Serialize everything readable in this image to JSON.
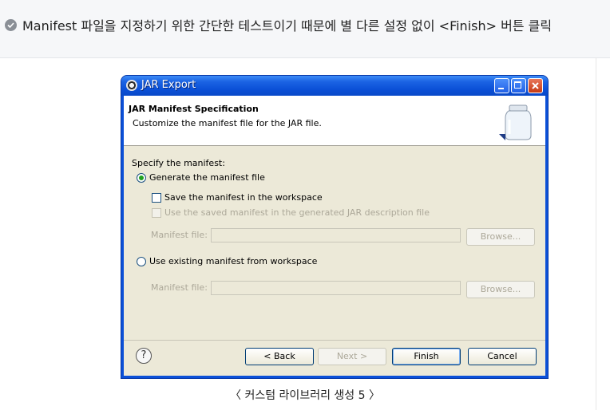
{
  "page": {
    "heading": "Manifest 파일을 지정하기 위한 간단한 테스트이기 때문에 별 다른 설정 없이 <Finish> 버튼 클릭",
    "caption": "〈 커스텀 라이브러리 생성 5 〉"
  },
  "window": {
    "title": "JAR Export",
    "controls": [
      "minimize-icon",
      "maximize-icon",
      "close-icon"
    ]
  },
  "banner": {
    "title": "JAR Manifest Specification",
    "description": "Customize the manifest file for the JAR file.",
    "icon": "jar-icon"
  },
  "form": {
    "section_label": "Specify the manifest:",
    "generate_option": "Generate the manifest file",
    "generate_selected": true,
    "save_option": "Save the manifest in the workspace",
    "save_checked": false,
    "use_saved_option": "Use the saved manifest in the generated JAR description file",
    "use_saved_enabled": false,
    "manifest_file_label_1": "Manifest file:",
    "manifest_file_value_1": "",
    "browse_1": "Browse...",
    "existing_option": "Use existing manifest from workspace",
    "existing_selected": false,
    "manifest_file_label_2": "Manifest file:",
    "manifest_file_value_2": "",
    "browse_2": "Browse..."
  },
  "buttons": {
    "help": "?",
    "back": "< Back",
    "next": "Next >",
    "finish": "Finish",
    "cancel": "Cancel"
  },
  "colors": {
    "titlebar": "#0b50d8",
    "dialog_bg": "#ece9d8",
    "radio_dot": "#21a121"
  }
}
